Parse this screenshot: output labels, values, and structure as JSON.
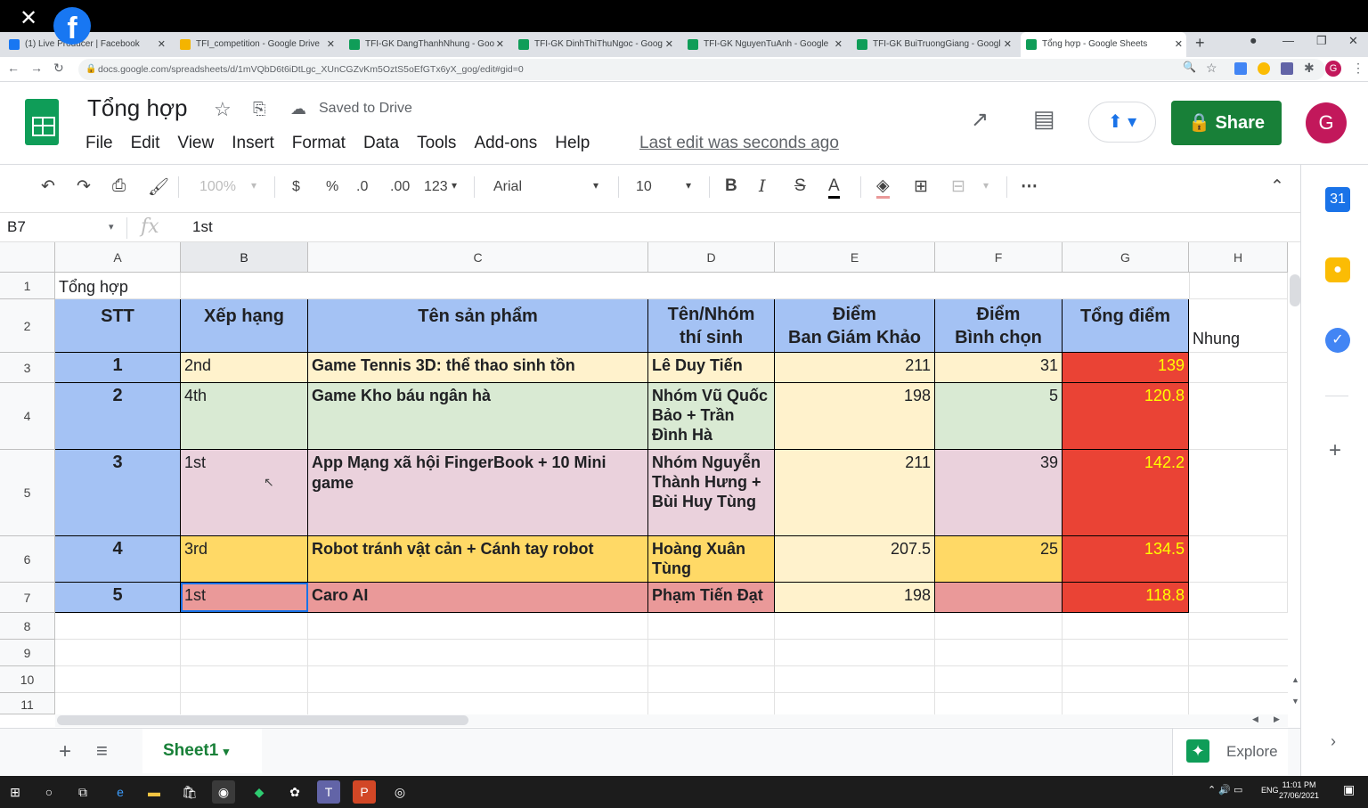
{
  "browser": {
    "tabs": [
      {
        "label": "(1) Live Producer | Facebook",
        "color": "#1877f2",
        "active": false
      },
      {
        "label": "TFI_competition - Google Drive",
        "color": "#f4b400",
        "active": false
      },
      {
        "label": "TFI-GK DangThanhNhung - Goo",
        "color": "#0f9d58",
        "active": false
      },
      {
        "label": "TFI-GK DinhThiThuNgoc - Goog",
        "color": "#0f9d58",
        "active": false
      },
      {
        "label": "TFI-GK NguyenTuAnh - Google",
        "color": "#0f9d58",
        "active": false
      },
      {
        "label": "TFI-GK BuiTruongGiang - Googl",
        "color": "#0f9d58",
        "active": false
      },
      {
        "label": "Tổng hợp - Google Sheets",
        "color": "#0f9d58",
        "active": true
      }
    ],
    "url": "docs.google.com/spreadsheets/d/1mVQbD6t6iDtLgc_XUnCGZvKm5OztS5oEfGTx6yX_gog/edit#gid=0",
    "profile_initial": "G"
  },
  "doc": {
    "title": "Tổng hợp",
    "saved_status": "Saved to Drive",
    "last_edit": "Last edit was seconds ago",
    "share_label": "Share",
    "avatar_initial": "G"
  },
  "menu": [
    "File",
    "Edit",
    "View",
    "Insert",
    "Format",
    "Data",
    "Tools",
    "Add-ons",
    "Help"
  ],
  "toolbar": {
    "zoom": "100%",
    "currency": "$",
    "percent": "%",
    "dec_decrease": ".0",
    "dec_increase": ".00",
    "more_formats": "123",
    "font": "Arial",
    "font_size": "10"
  },
  "formula_bar": {
    "cell_ref": "B7",
    "value": "1st"
  },
  "columns": [
    "A",
    "B",
    "C",
    "D",
    "E",
    "F",
    "G",
    "H"
  ],
  "rows": [
    "1",
    "2",
    "3",
    "4",
    "5",
    "6",
    "7",
    "8",
    "9",
    "10",
    "11"
  ],
  "sheet": {
    "a1": "Tổng hợp",
    "h2": "Nhung",
    "headers": {
      "stt": "STT",
      "rank": "Xếp hạng",
      "product": "Tên sản phẩm",
      "team_l1": "Tên/Nhóm",
      "team_l2": "thí sinh",
      "judges_l1": "Điểm",
      "judges_l2": "Ban Giám Khảo",
      "vote_l1": "Điểm",
      "vote_l2": "Bình chọn",
      "total": "Tổng điểm"
    },
    "entries": [
      {
        "stt": "1",
        "rank": "2nd",
        "product": "Game Tennis 3D: thể thao sinh tồn",
        "team": "Lê Duy Tiến",
        "judges": "211",
        "vote": "31",
        "total": "139"
      },
      {
        "stt": "2",
        "rank": "4th",
        "product": "Game Kho báu ngân hà",
        "team": "Nhóm Vũ Quốc Bảo + Trần Đình Hà",
        "judges": "198",
        "vote": "5",
        "total": "120.8"
      },
      {
        "stt": "3",
        "rank": "1st",
        "product": "App Mạng xã hội FingerBook + 10 Mini game",
        "team": "Nhóm Nguyễn Thành Hưng + Bùi Huy Tùng",
        "judges": "211",
        "vote": "39",
        "total": "142.2"
      },
      {
        "stt": "4",
        "rank": "3rd",
        "product": "Robot tránh vật cản + Cánh tay robot",
        "team": "Hoàng Xuân Tùng",
        "judges": "207.5",
        "vote": "25",
        "total": "134.5"
      },
      {
        "stt": "5",
        "rank": "1st",
        "product": "Caro AI",
        "team": "Phạm Tiến Đạt",
        "judges": "198",
        "vote": "",
        "total": "118.8"
      }
    ]
  },
  "sheet_tabs": {
    "active": "Sheet1",
    "explore": "Explore"
  },
  "taskbar": {
    "lang": "ENG",
    "time": "11:01 PM",
    "date": "27/06/2021"
  },
  "colors": {
    "header_blue": "#a4c2f4",
    "row_cream": "#fff2cc",
    "row_green": "#d9ead3",
    "row_pink": "#ead1dc",
    "row_orange": "#ffd966",
    "row_red": "#ea9999",
    "total_red": "#ea4335",
    "share_green": "#188038"
  }
}
